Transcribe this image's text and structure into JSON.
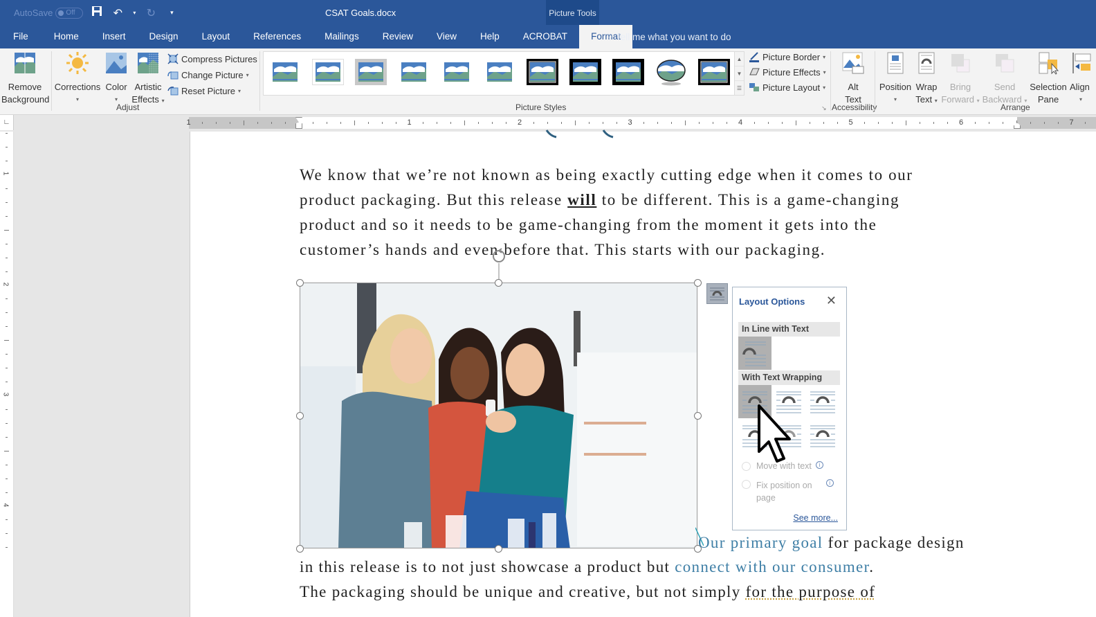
{
  "titlebar": {
    "autosave_label": "AutoSave",
    "autosave_state": "Off",
    "doc_title": "CSAT Goals.docx",
    "context_tab_group": "Picture Tools",
    "qat_icons": [
      "save-icon",
      "undo-icon",
      "undo-dropdown-icon",
      "redo-icon",
      "customize-qat-icon"
    ]
  },
  "tabs": [
    {
      "label": "File"
    },
    {
      "label": "Home"
    },
    {
      "label": "Insert"
    },
    {
      "label": "Design"
    },
    {
      "label": "Layout"
    },
    {
      "label": "References"
    },
    {
      "label": "Mailings"
    },
    {
      "label": "Review"
    },
    {
      "label": "View"
    },
    {
      "label": "Help"
    },
    {
      "label": "ACROBAT"
    },
    {
      "label": "Format",
      "active": true
    }
  ],
  "tell_me": "Tell me what you want to do",
  "ribbon": {
    "adjust": {
      "remove_background": [
        "Remove",
        "Background"
      ],
      "corrections": "Corrections",
      "color": "Color",
      "artistic_effects": [
        "Artistic",
        "Effects"
      ],
      "compress_pictures": "Compress Pictures",
      "change_picture": "Change Picture",
      "reset_picture": "Reset Picture",
      "label": "Adjust"
    },
    "picture_styles": {
      "label": "Picture Styles",
      "style_count": 11,
      "picture_border": "Picture Border",
      "picture_effects": "Picture Effects",
      "picture_layout": "Picture Layout"
    },
    "accessibility": {
      "alt_text": [
        "Alt",
        "Text"
      ],
      "label": "Accessibility"
    },
    "arrange": {
      "position": "Position",
      "wrap_text": [
        "Wrap",
        "Text"
      ],
      "bring_forward": [
        "Bring",
        "Forward"
      ],
      "send_backward": [
        "Send",
        "Backward"
      ],
      "selection_pane": [
        "Selection",
        "Pane"
      ],
      "align": "Align",
      "label": "Arrange"
    }
  },
  "ruler": {
    "h_numbers": [
      "1",
      "1",
      "2",
      "3",
      "4",
      "5",
      "6",
      "7"
    ],
    "v_numbers": [
      "1",
      "2",
      "3",
      "4"
    ]
  },
  "document": {
    "para1": [
      "We know that we’re not known as being exactly cutting edge when it comes to our",
      [
        "product packaging. But this release ",
        "will",
        " to be different. This is a game-changing"
      ],
      "product and so it needs to be game-changing from the moment it gets into the",
      "customer’s hands and even before that. This starts with our packaging."
    ],
    "para2_line1": [
      "Our primary goal",
      " for package design"
    ],
    "para2_line2": [
      "in this release is to not just showcase a product but ",
      "connect with our consumer",
      "."
    ],
    "para2_line3": [
      "The packaging should be unique and creative, but not simply ",
      "for the purpose of"
    ],
    "image_alt": "Three women smiling while looking at a product in a store"
  },
  "layout_options": {
    "title": "Layout Options",
    "in_line_heading": "In Line with Text",
    "wrapping_heading": "With Text Wrapping",
    "move_with_text": "Move with text",
    "fix_position": [
      "Fix position on",
      "page"
    ],
    "see_more": "See more..."
  },
  "colors": {
    "brand": "#2b579a",
    "link": "#3f7fa6"
  }
}
